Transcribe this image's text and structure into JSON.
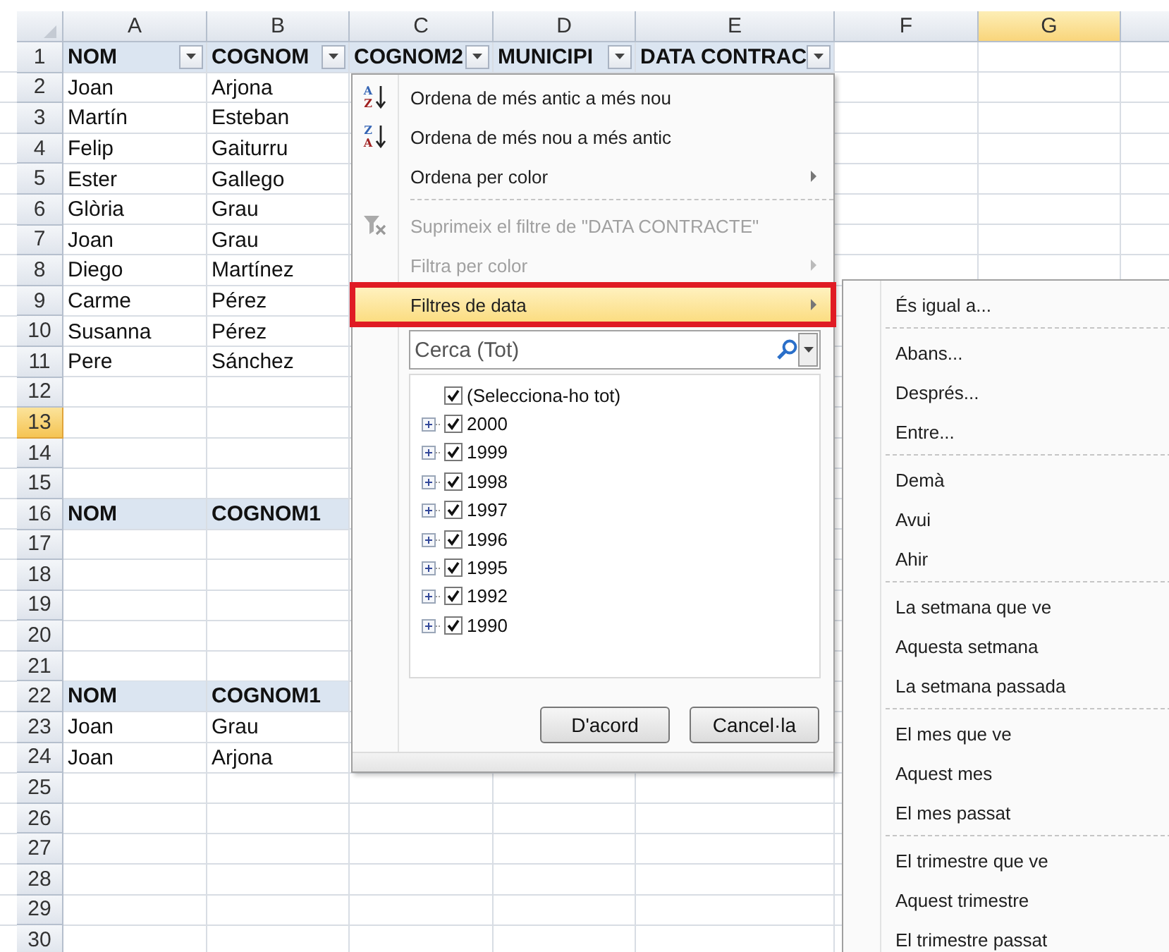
{
  "columns": [
    {
      "label": "A",
      "selected": false
    },
    {
      "label": "B",
      "selected": false
    },
    {
      "label": "C",
      "selected": false
    },
    {
      "label": "D",
      "selected": false
    },
    {
      "label": "E",
      "selected": false
    },
    {
      "label": "F",
      "selected": false
    },
    {
      "label": "G",
      "selected": true
    }
  ],
  "rows": [
    {
      "number": "1",
      "selected": false,
      "cells": [
        {
          "text": "NOM",
          "filter_button": true
        },
        {
          "text": "COGNOM",
          "filter_button": true
        },
        {
          "text": "COGNOM2",
          "filter_button": true
        },
        {
          "text": "MUNICIPI",
          "filter_button": true
        },
        {
          "text": "DATA CONTRAC",
          "filter_button": true
        }
      ]
    },
    {
      "number": "2",
      "selected": false,
      "cells": [
        {
          "text": "Joan"
        },
        {
          "text": "Arjona"
        }
      ]
    },
    {
      "number": "3",
      "selected": false,
      "cells": [
        {
          "text": "Martín"
        },
        {
          "text": "Esteban"
        }
      ]
    },
    {
      "number": "4",
      "selected": false,
      "cells": [
        {
          "text": "Felip"
        },
        {
          "text": "Gaiturru"
        }
      ]
    },
    {
      "number": "5",
      "selected": false,
      "cells": [
        {
          "text": "Ester"
        },
        {
          "text": "Gallego"
        }
      ]
    },
    {
      "number": "6",
      "selected": false,
      "cells": [
        {
          "text": "Glòria"
        },
        {
          "text": "Grau"
        }
      ]
    },
    {
      "number": "7",
      "selected": false,
      "cells": [
        {
          "text": "Joan"
        },
        {
          "text": "Grau"
        }
      ]
    },
    {
      "number": "8",
      "selected": false,
      "cells": [
        {
          "text": "Diego"
        },
        {
          "text": "Martínez"
        }
      ]
    },
    {
      "number": "9",
      "selected": false,
      "cells": [
        {
          "text": "Carme"
        },
        {
          "text": "Pérez"
        }
      ]
    },
    {
      "number": "10",
      "selected": false,
      "cells": [
        {
          "text": "Susanna"
        },
        {
          "text": "Pérez"
        }
      ]
    },
    {
      "number": "11",
      "selected": false,
      "cells": [
        {
          "text": "Pere"
        },
        {
          "text": "Sánchez"
        }
      ]
    },
    {
      "number": "12",
      "selected": false
    },
    {
      "number": "13",
      "selected": true
    },
    {
      "number": "14",
      "selected": false
    },
    {
      "number": "15",
      "selected": false
    },
    {
      "number": "16",
      "selected": false,
      "cells": [
        {
          "text": "NOM",
          "filter_button": false
        },
        {
          "text": "COGNOM1",
          "filter_button": false
        }
      ]
    },
    {
      "number": "17",
      "selected": false
    },
    {
      "number": "18",
      "selected": false
    },
    {
      "number": "19",
      "selected": false
    },
    {
      "number": "20",
      "selected": false
    },
    {
      "number": "21",
      "selected": false
    },
    {
      "number": "22",
      "selected": false,
      "cells": [
        {
          "text": "NOM",
          "filter_button": false
        },
        {
          "text": "COGNOM1",
          "filter_button": false
        }
      ]
    },
    {
      "number": "23",
      "selected": false,
      "cells": [
        {
          "text": "Joan"
        },
        {
          "text": "Grau"
        }
      ]
    },
    {
      "number": "24",
      "selected": false,
      "cells": [
        {
          "text": "Joan"
        },
        {
          "text": "Arjona"
        }
      ]
    },
    {
      "number": "25",
      "selected": false
    },
    {
      "number": "26",
      "selected": false
    },
    {
      "number": "27",
      "selected": false
    },
    {
      "number": "28",
      "selected": false
    },
    {
      "number": "29",
      "selected": false
    },
    {
      "number": "30",
      "selected": false
    }
  ],
  "filter_menu": {
    "items": [
      {
        "kind": "sort_item",
        "label": "Ordena de més antic a més nou",
        "icon_letters": [
          "A",
          "Z"
        ],
        "disabled": false,
        "selected": false,
        "submenu": false,
        "outlined": false
      },
      {
        "kind": "sort_item",
        "label": "Ordena de més nou a més antic",
        "icon_letters": [
          "Z",
          "A"
        ],
        "disabled": false,
        "selected": false,
        "submenu": false,
        "outlined": false
      },
      {
        "kind": "item",
        "label": "Ordena per color",
        "disabled": false,
        "selected": false,
        "submenu": true,
        "outlined": false
      },
      {
        "kind": "separator"
      },
      {
        "kind": "clear_filter_item",
        "label": "Suprimeix el filtre de \"DATA CONTRACTE\"",
        "disabled": true,
        "selected": false,
        "submenu": false,
        "outlined": false
      },
      {
        "kind": "item",
        "label": "Filtra per color",
        "disabled": true,
        "selected": false,
        "submenu": true,
        "outlined": false
      },
      {
        "kind": "item",
        "label": "Filtres de data",
        "disabled": false,
        "selected": true,
        "submenu": true,
        "outlined": true
      }
    ],
    "search": {
      "placeholder": "Cerca (Tot)"
    },
    "tree": [
      {
        "label": "(Selecciona-ho tot)",
        "checked": true
      },
      {
        "label": "2000",
        "checked": true,
        "expanded": false
      },
      {
        "label": "1999",
        "checked": true,
        "expanded": false
      },
      {
        "label": "1998",
        "checked": true,
        "expanded": false
      },
      {
        "label": "1997",
        "checked": true,
        "expanded": false
      },
      {
        "label": "1996",
        "checked": true,
        "expanded": false
      },
      {
        "label": "1995",
        "checked": true,
        "expanded": false
      },
      {
        "label": "1992",
        "checked": true,
        "expanded": false
      },
      {
        "label": "1990",
        "checked": true,
        "expanded": false
      }
    ],
    "buttons": [
      "D'acord",
      "Cancel·la"
    ]
  },
  "date_filter_menu": {
    "items": [
      {
        "kind": "item",
        "label": "És igual a..."
      },
      {
        "kind": "separator"
      },
      {
        "kind": "item",
        "label": "Abans..."
      },
      {
        "kind": "item",
        "label": "Després..."
      },
      {
        "kind": "item",
        "label": "Entre..."
      },
      {
        "kind": "separator"
      },
      {
        "kind": "item",
        "label": "Demà"
      },
      {
        "kind": "item",
        "label": "Avui"
      },
      {
        "kind": "item",
        "label": "Ahir"
      },
      {
        "kind": "separator"
      },
      {
        "kind": "item",
        "label": "La setmana que ve"
      },
      {
        "kind": "item",
        "label": "Aquesta setmana"
      },
      {
        "kind": "item",
        "label": "La setmana passada"
      },
      {
        "kind": "separator"
      },
      {
        "kind": "item",
        "label": "El mes que ve"
      },
      {
        "kind": "item",
        "label": "Aquest mes"
      },
      {
        "kind": "item",
        "label": "El mes passat"
      },
      {
        "kind": "separator"
      },
      {
        "kind": "item",
        "label": "El trimestre que ve"
      },
      {
        "kind": "item",
        "label": "Aquest trimestre"
      },
      {
        "kind": "item",
        "label": "El trimestre passat"
      }
    ]
  }
}
